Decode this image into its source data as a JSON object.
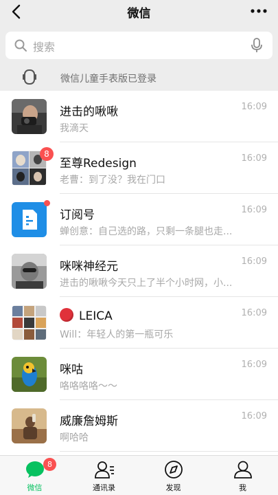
{
  "header": {
    "title": "微信",
    "back_icon": "chevron-left-icon",
    "more_icon": "more-dots-icon"
  },
  "search": {
    "placeholder": "搜索",
    "icon": "search-icon",
    "voice_icon": "microphone-icon"
  },
  "watch_bar": {
    "text": "微信儿童手表版已登录",
    "icon": "watch-icon"
  },
  "chats": [
    {
      "name": "进击的啾啾",
      "message": "我滴天",
      "time": "16:09",
      "badge": "",
      "dot": false
    },
    {
      "name": "至尊Redesign",
      "message": "老曹：到了没？我在门口",
      "time": "16:09",
      "badge": "8",
      "dot": false
    },
    {
      "name": "订阅号",
      "message": "蝉创意：自己选的路，只剩一条腿也走...",
      "time": "16:09",
      "badge": "",
      "dot": true
    },
    {
      "name": "咪咪神经元",
      "message": "进击的啾啾今天只上了半个小时网，小...",
      "time": "16:09",
      "badge": "",
      "dot": false
    },
    {
      "name": "LEICA",
      "message": "Will：年轻人的第一瓶可乐",
      "time": "16:09",
      "badge": "",
      "dot": false
    },
    {
      "name": "咪咕",
      "message": "咯咯咯咯～～",
      "time": "16:09",
      "badge": "",
      "dot": false
    },
    {
      "name": "威廉詹姆斯",
      "message": "啊哈哈",
      "time": "16:09",
      "badge": "",
      "dot": false
    }
  ],
  "tabbar": {
    "tabs": [
      {
        "label": "微信",
        "icon": "chat-bubble-icon",
        "badge": "8",
        "active": true
      },
      {
        "label": "通讯录",
        "icon": "contacts-icon",
        "badge": "",
        "active": false
      },
      {
        "label": "发现",
        "icon": "compass-icon",
        "badge": "",
        "active": false
      },
      {
        "label": "我",
        "icon": "person-icon",
        "badge": "",
        "active": false
      }
    ]
  },
  "colors": {
    "accent": "#07c160",
    "badge": "#fa5151",
    "background": "#ededed"
  }
}
